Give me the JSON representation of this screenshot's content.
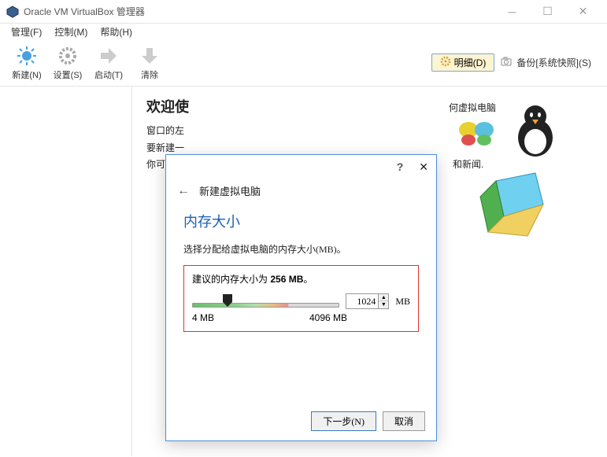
{
  "window": {
    "title": "Oracle VM VirtualBox 管理器"
  },
  "menubar": {
    "items": [
      "管理(F)",
      "控制(M)",
      "帮助(H)"
    ]
  },
  "toolbar": {
    "new": "新建(N)",
    "settings": "设置(S)",
    "start": "启动(T)",
    "clear": "清除",
    "detail": "明细(D)",
    "snapshot": "备份[系统快照](S)"
  },
  "welcome": {
    "title": "欢迎使",
    "line1": "窗口的左",
    "line2": "要新建一",
    "line3": "你可以按",
    "right1": "何虚拟电脑",
    "right2": "和新闻."
  },
  "dialog": {
    "header_title": "新建虚拟电脑",
    "section_title": "内存大小",
    "section_desc": "选择分配给虚拟电脑的内存大小(MB)。",
    "recommend_prefix": "建议的内存大小为 ",
    "recommend_value": "256 MB",
    "recommend_suffix": "。",
    "spinner_value": "1024",
    "unit": "MB",
    "min_label": "4 MB",
    "max_label": "4096 MB",
    "next": "下一步(N)",
    "cancel": "取消"
  }
}
